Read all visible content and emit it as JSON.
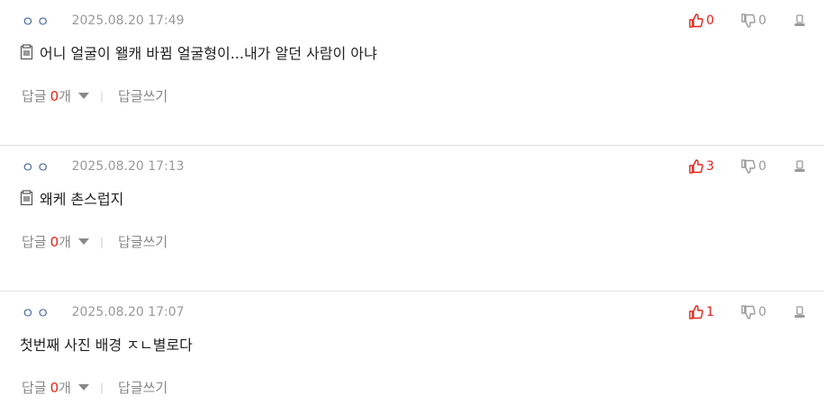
{
  "comments": [
    {
      "author": "ㅇㅇ",
      "date": "2025.08.20 17:49",
      "upvotes": "0",
      "downvotes": "0",
      "has_doc_icon": true,
      "text": "어니 얼굴이 왤캐 바뀜 얼굴형이...내가 알던 사람이 아냐",
      "reply_label": "답글",
      "reply_count": "0",
      "reply_count_suffix": "개",
      "write_reply_label": "답글쓰기"
    },
    {
      "author": "ㅇㅇ",
      "date": "2025.08.20 17:13",
      "upvotes": "3",
      "downvotes": "0",
      "has_doc_icon": true,
      "text": "왜케 촌스럽지",
      "reply_label": "답글",
      "reply_count": "0",
      "reply_count_suffix": "개",
      "write_reply_label": "답글쓰기"
    },
    {
      "author": "ㅇㅇ",
      "date": "2025.08.20 17:07",
      "upvotes": "1",
      "downvotes": "0",
      "has_doc_icon": false,
      "text": "첫번째 사진 배경 ㅈㄴ별로다",
      "reply_label": "답글",
      "reply_count": "0",
      "reply_count_suffix": "개",
      "write_reply_label": "답글쓰기"
    }
  ],
  "colors": {
    "accent_red": "#e2231a",
    "author_blue": "#4a6aa5",
    "muted_gray": "#999999"
  },
  "icons": {
    "upvote": "thumbs-up-icon",
    "downvote": "thumbs-down-icon",
    "report": "report-icon",
    "doc": "document-icon",
    "caret": "caret-down-icon"
  }
}
